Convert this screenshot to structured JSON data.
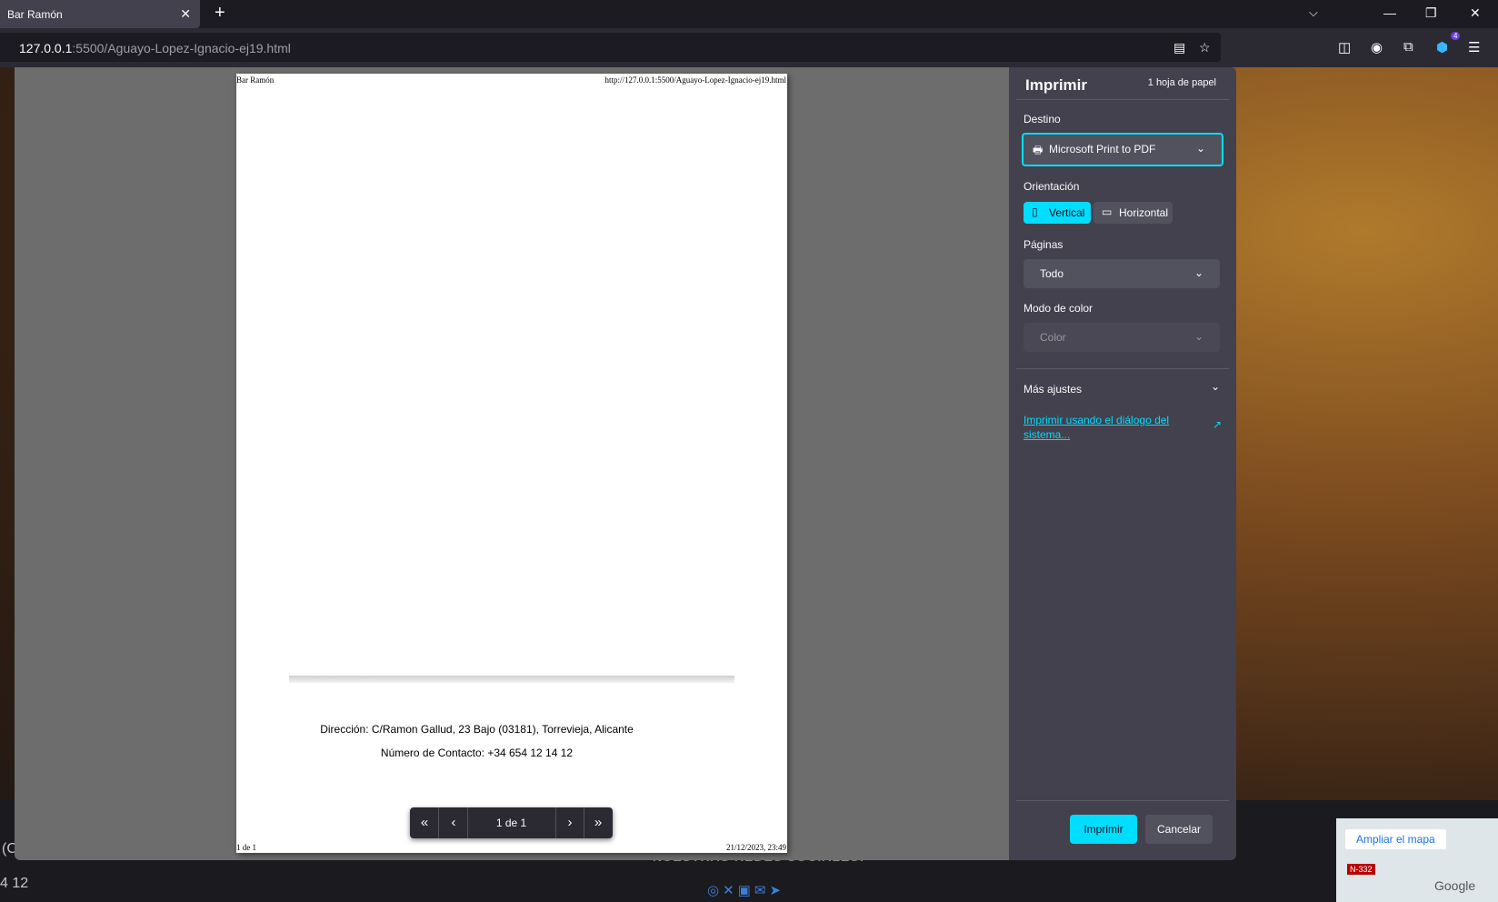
{
  "browser": {
    "tab": {
      "title": "Bar Ramón",
      "close_glyph": "✕"
    },
    "new_tab_glyph": "+",
    "tab_list_glyph": "⌵",
    "window": {
      "minimize": "—",
      "restore": "❐",
      "close": "✕"
    },
    "url": {
      "host": "127.0.0.1",
      "rest": ":5500/Aguayo-Lopez-Ignacio-ej19.html"
    },
    "extensions_badge": "4",
    "icons": [
      "reader-view-icon",
      "bookmark-star-icon",
      "pocket-icon",
      "account-icon",
      "extensions-icon",
      "addon-icon",
      "menu-icon"
    ]
  },
  "background_page": {
    "left_text_1": "(C",
    "left_text_2": "4 12",
    "footer_heading": "NUESTRAS REDES SOCIALES:",
    "social_icons": [
      "instagram-icon",
      "x-icon",
      "facebook-icon",
      "email-icon",
      "telegram-icon"
    ],
    "map": {
      "button": "Ampliar el mapa",
      "road": "N-332",
      "label": "Google"
    }
  },
  "preview": {
    "header_left": "Bar Ramón",
    "header_right": "http://127.0.0.1:5500/Aguayo-Lopez-Ignacio-ej19.html",
    "footer_left": "1 de 1",
    "footer_right": "21/12/2023, 23:49",
    "address": "Dirección: C/Ramon Gallud, 23 Bajo (03181), Torrevieja, Alicante",
    "phone": "Número de Contacto: +34 654 12 14 12",
    "pager": {
      "first": "«",
      "prev": "‹",
      "status": "1 de 1",
      "next": "›",
      "last": "»"
    }
  },
  "print_panel": {
    "title": "Imprimir",
    "sheets": "1 hoja de papel",
    "destination_label": "Destino",
    "destination_value": "Microsoft Print to PDF",
    "orientation_label": "Orientación",
    "orientation_vertical": "Vertical",
    "orientation_horizontal": "Horizontal",
    "orientation_selected": "Vertical",
    "pages_label": "Páginas",
    "pages_value": "Todo",
    "color_label": "Modo de color",
    "color_value": "Color",
    "more_settings": "Más ajustes",
    "system_dialog_link": "Imprimir usando el diálogo del sistema...",
    "print_button": "Imprimir",
    "cancel_button": "Cancelar",
    "accent_color": "#00ddff"
  }
}
